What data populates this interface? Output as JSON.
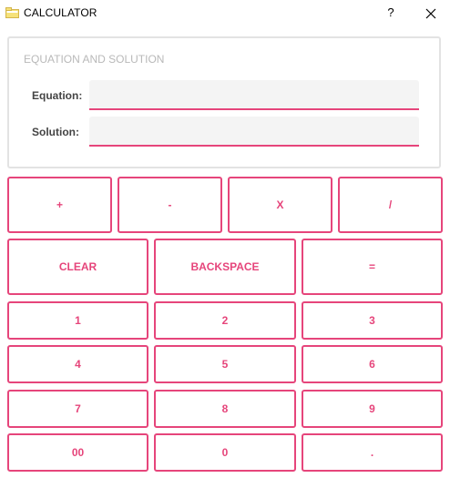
{
  "window": {
    "title": "CALCULATOR",
    "help_label": "?",
    "icon": "folder-icon",
    "close_icon": "close-icon"
  },
  "group": {
    "title": "EQUATION AND SOLUTION",
    "equation_label": "Equation:",
    "equation_value": "",
    "solution_label": "Solution:",
    "solution_value": ""
  },
  "operators": {
    "add": "+",
    "subtract": "-",
    "multiply": "X",
    "divide": "/"
  },
  "controls": {
    "clear": "CLEAR",
    "backspace": "BACKSPACE",
    "equals": "="
  },
  "digits": {
    "d1": "1",
    "d2": "2",
    "d3": "3",
    "d4": "4",
    "d5": "5",
    "d6": "6",
    "d7": "7",
    "d8": "8",
    "d9": "9",
    "d00": "00",
    "d0": "0",
    "dot": "."
  },
  "colors": {
    "accent": "#e6457b",
    "group_border": "#e3e3e3",
    "input_bg": "#f4f4f4"
  }
}
